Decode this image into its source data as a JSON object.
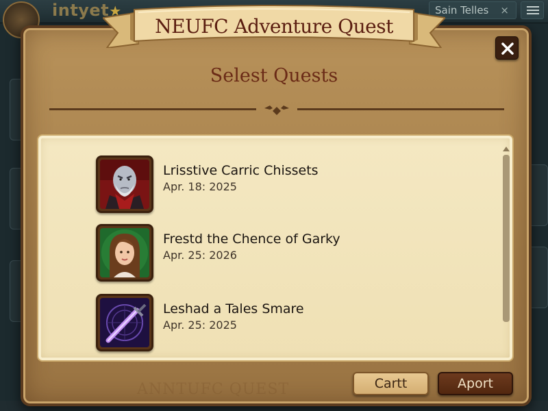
{
  "background": {
    "logo_text": "intyet",
    "user_chip": "Sain Telles",
    "user_chip_close": "×"
  },
  "modal": {
    "ribbon_title": "NEUFC Adventure Quest",
    "subtitle": "Selest Quests",
    "watermark": "ANNTUFC QUEST"
  },
  "quests": [
    {
      "name": "Lrisstive Carric Chissets",
      "date": "Apr. 18: 2025",
      "portrait_icon": "old-warrior-portrait"
    },
    {
      "name": "Frestd the Chence of Garky",
      "date": "Apr. 25: 2026",
      "portrait_icon": "young-woman-portrait"
    },
    {
      "name": "Leshad a Tales Smare",
      "date": "Apr. 25: 2025",
      "portrait_icon": "magic-sword-portrait"
    }
  ],
  "buttons": {
    "cart": "Cartt",
    "apply": "Aport"
  },
  "colors": {
    "modal_frame": "#a47e4a",
    "parchment": "#f4e8c2",
    "title_red": "#5a1d10",
    "dark_button": "#52270f"
  }
}
